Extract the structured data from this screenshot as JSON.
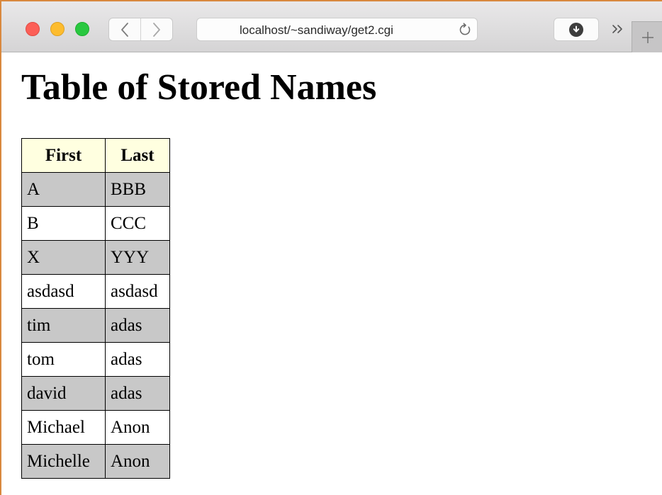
{
  "browser": {
    "url": "localhost/~sandiway/get2.cgi",
    "icons": {
      "close": "close-button",
      "minimize": "minimize-button",
      "maximize": "maximize-button",
      "back": "chevron-left-icon",
      "forward": "chevron-right-icon",
      "reload": "reload-icon",
      "download": "download-icon",
      "overflow": "double-chevron-icon",
      "new_tab": "plus-icon"
    },
    "colors": {
      "close": "#fc5f57",
      "minimize": "#fdbc2e",
      "maximize": "#29c840"
    }
  },
  "page": {
    "title": "Table of Stored Names",
    "table": {
      "headers": [
        "First",
        "Last"
      ],
      "rows": [
        [
          "A",
          "BBB"
        ],
        [
          "B",
          "CCC"
        ],
        [
          "X",
          "YYY"
        ],
        [
          "asdasd",
          "asdasd"
        ],
        [
          "tim",
          "adas"
        ],
        [
          "tom",
          "adas"
        ],
        [
          "david",
          "adas"
        ],
        [
          "Michael",
          "Anon"
        ],
        [
          "Michelle",
          "Anon"
        ]
      ],
      "colors": {
        "header_bg": "#ffffe0",
        "odd_row_bg": "#c8c8c8",
        "even_row_bg": "#ffffff"
      }
    }
  }
}
